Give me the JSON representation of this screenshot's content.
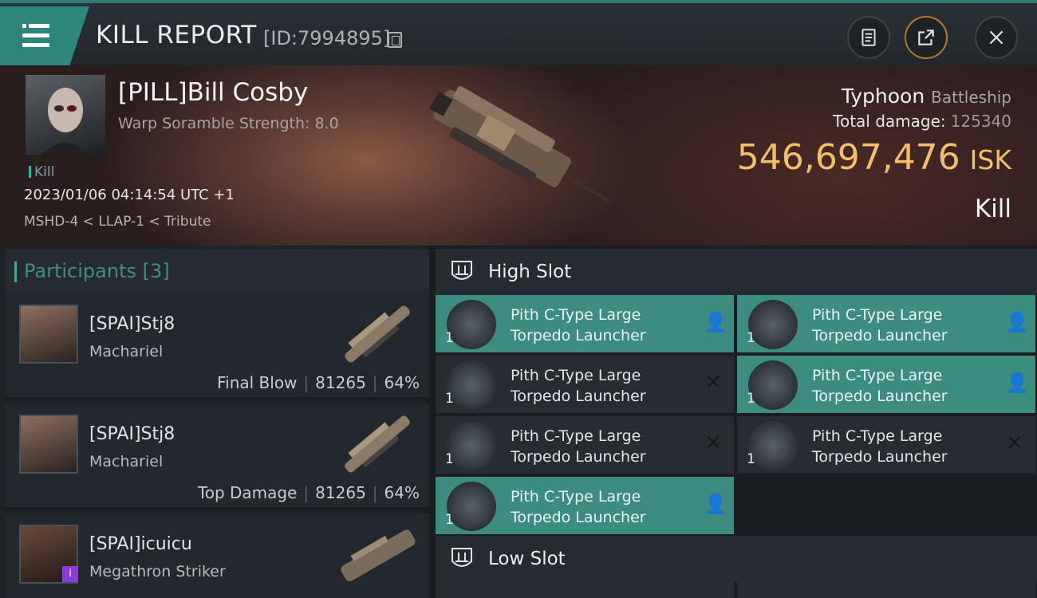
{
  "header": {
    "title": "KILL REPORT",
    "id_text": "[ID:7994895]"
  },
  "victim": {
    "name": "[PILL]Bill Cosby",
    "sub": "Warp Soramble Strength: 8.0",
    "kill_tag": "Kill",
    "time": "2023/01/06 04:14:54 UTC +1",
    "location": "MSHD-4 < LLAP-1 < Tribute",
    "ship_name": "Typhoon",
    "ship_class": "Battleship",
    "damage_label": "Total damage:",
    "damage_value": "125340",
    "isk_value": "546,697,476",
    "isk_unit": "ISK",
    "result": "Kill"
  },
  "participants": {
    "title": "Participants [3]",
    "items": [
      {
        "name": "[SPAI]Stj8",
        "ship": "Machariel",
        "role": "Final Blow",
        "damage": "81265",
        "percent": "64%"
      },
      {
        "name": "[SPAI]Stj8",
        "ship": "Machariel",
        "role": "Top Damage",
        "damage": "81265",
        "percent": "64%"
      },
      {
        "name": "[SPAI]icuicu",
        "ship": "Megathron Striker",
        "badge": "i"
      }
    ]
  },
  "slots": {
    "high_label": "High Slot",
    "low_label": "Low Slot",
    "modules": [
      {
        "name_l1": "Pith C-Type Large",
        "name_l2": "Torpedo Launcher",
        "qty": "1",
        "state": "dropped"
      },
      {
        "name_l1": "Pith C-Type Large",
        "name_l2": "Torpedo Launcher",
        "qty": "1",
        "state": "dropped"
      },
      {
        "name_l1": "Pith C-Type Large",
        "name_l2": "Torpedo Launcher",
        "qty": "1",
        "state": "destroyed"
      },
      {
        "name_l1": "Pith C-Type Large",
        "name_l2": "Torpedo Launcher",
        "qty": "1",
        "state": "dropped"
      },
      {
        "name_l1": "Pith C-Type Large",
        "name_l2": "Torpedo Launcher",
        "qty": "1",
        "state": "destroyed"
      },
      {
        "name_l1": "Pith C-Type Large",
        "name_l2": "Torpedo Launcher",
        "qty": "1",
        "state": "destroyed"
      },
      {
        "name_l1": "Pith C-Type Large",
        "name_l2": "Torpedo Launcher",
        "qty": "1",
        "state": "dropped"
      }
    ]
  },
  "colors": {
    "accent": "#2d8679",
    "isk": "#f2c06a",
    "dropped_bg": "#3c8c80",
    "destroyed_bg": "#262c31"
  }
}
